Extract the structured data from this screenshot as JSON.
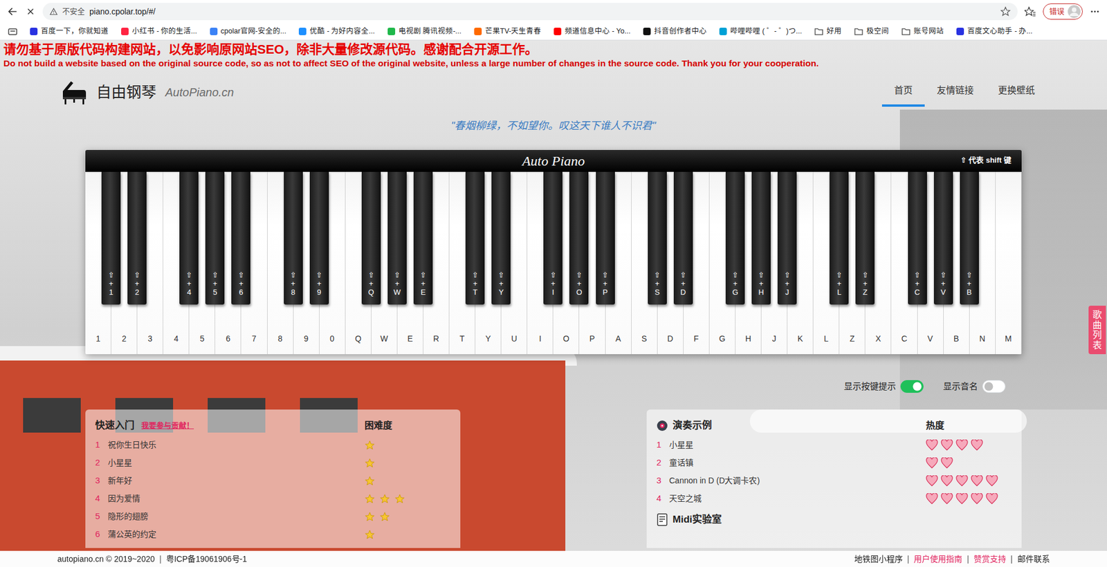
{
  "browser": {
    "security": "不安全",
    "url": "piano.cpolar.top/#/",
    "profile": "错误"
  },
  "bookmarks": [
    {
      "label": "百度一下，你就知道",
      "kind": "site",
      "color": "#2932e1"
    },
    {
      "label": "小红书 - 你的生活...",
      "kind": "site",
      "color": "#ff2442"
    },
    {
      "label": "cpolar官网-安全的...",
      "kind": "site",
      "color": "#3b82f6"
    },
    {
      "label": "优酷 - 为好内容全...",
      "kind": "site",
      "color": "#1e90ff"
    },
    {
      "label": "电视剧 腾讯视频-...",
      "kind": "site",
      "color": "#20b84b"
    },
    {
      "label": "芒果TV-天生青春",
      "kind": "site",
      "color": "#ff6a00"
    },
    {
      "label": "频道信息中心 - Yo...",
      "kind": "site",
      "color": "#ff0000"
    },
    {
      "label": "抖音创作者中心",
      "kind": "site",
      "color": "#111111"
    },
    {
      "label": "哔哩哔哩 ( ゜- ゜)つ...",
      "kind": "site",
      "color": "#00a1d6"
    },
    {
      "label": "好用",
      "kind": "folder"
    },
    {
      "label": "极空间",
      "kind": "folder"
    },
    {
      "label": "账号网站",
      "kind": "folder"
    },
    {
      "label": "百度文心助手 - 办...",
      "kind": "site",
      "color": "#2932e1"
    }
  ],
  "notice": {
    "zh": "请勿基于原版代码构建网站，以免影响原网站SEO，除非大量修改源代码。感谢配合开源工作。",
    "en": "Do not build a website based on the original source code, so as not to affect SEO of the original website, unless a large number of changes in the source code. Thank you for your cooperation."
  },
  "brand": {
    "name": "自由钢琴",
    "domain": "AutoPiano.cn"
  },
  "nav": [
    {
      "label": "首页",
      "selected": true
    },
    {
      "label": "友情链接",
      "selected": false
    },
    {
      "label": "更换壁纸",
      "selected": false
    }
  ],
  "quote": "\"春烟柳绿，不如望你。叹这天下谁人不识君\"",
  "piano": {
    "logo": "Auto Piano",
    "shift_note": "⇧ 代表 shift 键",
    "shift_symbol": "⇧",
    "plus": "+",
    "keys": [
      {
        "label": "1",
        "black": "1"
      },
      {
        "label": "2",
        "black": "2"
      },
      {
        "label": "3",
        "black": null
      },
      {
        "label": "4",
        "black": "4"
      },
      {
        "label": "5",
        "black": "5"
      },
      {
        "label": "6",
        "black": "6"
      },
      {
        "label": "7",
        "black": null
      },
      {
        "label": "8",
        "black": "8"
      },
      {
        "label": "9",
        "black": "9"
      },
      {
        "label": "0",
        "black": null
      },
      {
        "label": "Q",
        "black": "Q"
      },
      {
        "label": "W",
        "black": "W"
      },
      {
        "label": "E",
        "black": "E"
      },
      {
        "label": "R",
        "black": null
      },
      {
        "label": "T",
        "black": "T"
      },
      {
        "label": "Y",
        "black": "Y"
      },
      {
        "label": "U",
        "black": null
      },
      {
        "label": "I",
        "black": "I"
      },
      {
        "label": "O",
        "black": "O"
      },
      {
        "label": "P",
        "black": "P"
      },
      {
        "label": "A",
        "black": null
      },
      {
        "label": "S",
        "black": "S"
      },
      {
        "label": "D",
        "black": "D"
      },
      {
        "label": "F",
        "black": null
      },
      {
        "label": "G",
        "black": "G"
      },
      {
        "label": "H",
        "black": "H"
      },
      {
        "label": "J",
        "black": "J"
      },
      {
        "label": "K",
        "black": null
      },
      {
        "label": "L",
        "black": "L"
      },
      {
        "label": "Z",
        "black": "Z"
      },
      {
        "label": "X",
        "black": null
      },
      {
        "label": "C",
        "black": "C"
      },
      {
        "label": "V",
        "black": "V"
      },
      {
        "label": "B",
        "black": "B"
      },
      {
        "label": "N",
        "black": null
      },
      {
        "label": "M",
        "black": null
      }
    ]
  },
  "toggles": [
    {
      "label": "显示按键提示",
      "on": true
    },
    {
      "label": "显示音名",
      "on": false
    }
  ],
  "side_tab": "歌曲列表",
  "quick_start": {
    "title": "快速入门",
    "contribute": "我要参与贡献！",
    "column": "困难度",
    "rows": [
      {
        "index": "1",
        "title": "祝你生日快乐",
        "stars": 1
      },
      {
        "index": "2",
        "title": "小星星",
        "stars": 1
      },
      {
        "index": "3",
        "title": "新年好",
        "stars": 1
      },
      {
        "index": "4",
        "title": "因为爱情",
        "stars": 3
      },
      {
        "index": "5",
        "title": "隐形的翅膀",
        "stars": 2
      },
      {
        "index": "6",
        "title": "蒲公英的约定",
        "stars": 1
      }
    ]
  },
  "examples": {
    "title": "演奏示例",
    "column": "热度",
    "rows": [
      {
        "index": "1",
        "title": "小星星",
        "hearts": 4
      },
      {
        "index": "2",
        "title": "童话镇",
        "hearts": 2
      },
      {
        "index": "3",
        "title": "Cannon in D (D大调卡农)",
        "hearts": 5
      },
      {
        "index": "4",
        "title": "天空之城",
        "hearts": 5
      }
    ],
    "midi_title": "Midi实验室"
  },
  "footer": {
    "copyright": "autopiano.cn © 2019~2020",
    "icp": "粤ICP备19061906号-1",
    "separator": "|",
    "links": [
      {
        "label": "地铁图小程序",
        "highlight": false
      },
      {
        "label": "用户使用指南",
        "highlight": true
      },
      {
        "label": "赞赏支持",
        "highlight": true
      },
      {
        "label": "邮件联系",
        "highlight": false
      }
    ]
  }
}
